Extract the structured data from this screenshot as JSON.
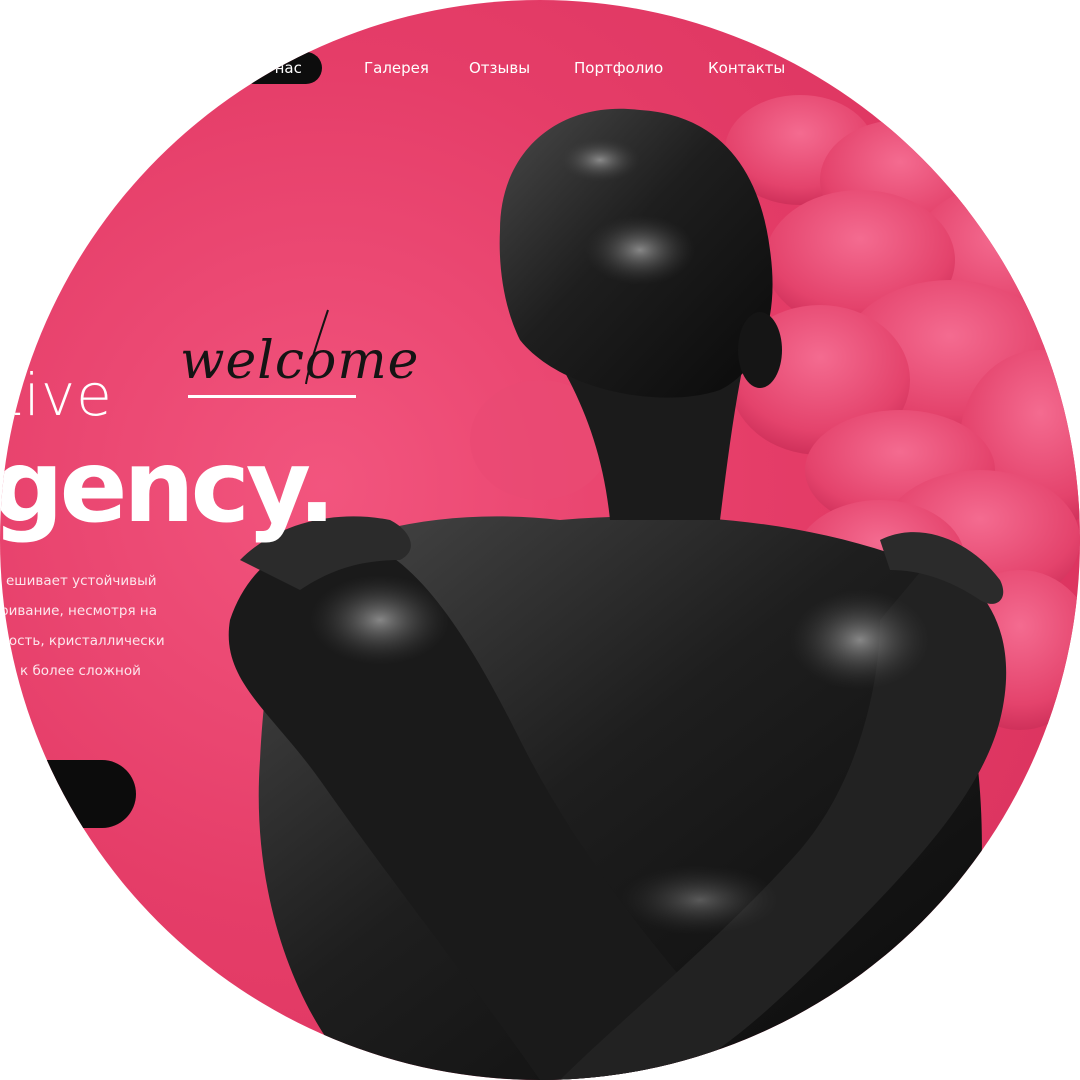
{
  "nav": {
    "items": [
      {
        "label": "О нас",
        "active": true
      },
      {
        "label": "Галерея",
        "active": false
      },
      {
        "label": "Отзывы",
        "active": false
      },
      {
        "label": "Портфолио",
        "active": false
      },
      {
        "label": "Контакты",
        "active": false
      }
    ]
  },
  "hero": {
    "script_word": "welcome",
    "title_light": "tive",
    "title_bold": "gency",
    "title_dot": ".",
    "description_lines": [
      "ешивает устойчивый",
      "ривание, несмотря на",
      "ность, кристаллически",
      "к более сложной"
    ]
  },
  "colors": {
    "accent": "#e53d68",
    "accent_light": "#f2557e",
    "dark": "#0d0d0d",
    "text": "#ffffff",
    "flower": "#ea4f78"
  },
  "icons": {
    "photo": "body-painted-figure",
    "flowers": "pink-flower-petals"
  }
}
